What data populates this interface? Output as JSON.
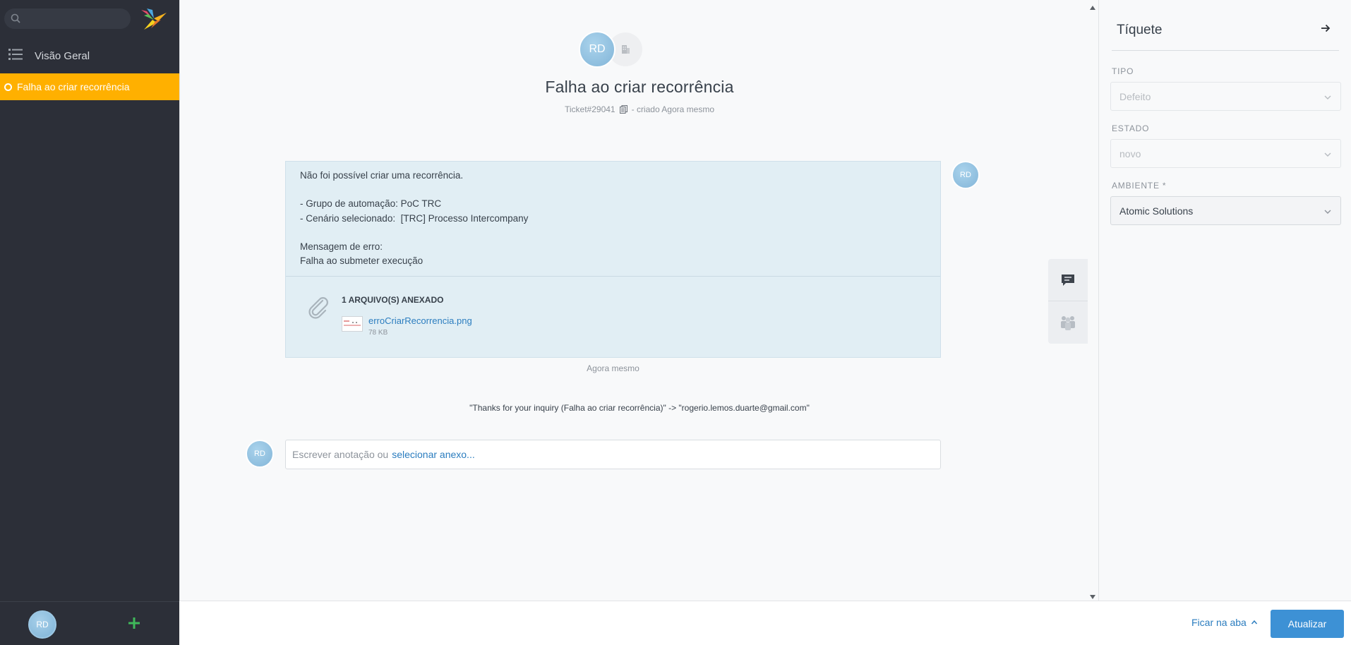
{
  "sidebar": {
    "search": {
      "placeholder": "",
      "value": ""
    },
    "overview_label": "Visão Geral",
    "open_ticket_label": "Falha ao criar recorrência",
    "user_initials": "RD"
  },
  "ticket": {
    "title": "Falha ao criar recorrência",
    "number": "Ticket#29041",
    "created": "- criado Agora mesmo",
    "header_initials": "RD"
  },
  "article": {
    "lines": [
      "Não foi possível criar uma recorrência.",
      "",
      "- Grupo de automação: PoC TRC",
      "- Cenário selecionado:  [TRC] Processo Intercompany",
      "",
      "Mensagem de erro:",
      "Falha ao submeter execução"
    ],
    "attachments_heading": "1 ARQUIVO(S) ANEXADO",
    "attachment": {
      "name": "erroCriarRecorrencia.png",
      "size": "78 KB"
    },
    "time": "Agora mesmo",
    "author_initials": "RD"
  },
  "trigger_note": "\"Thanks for your inquiry (Falha ao criar recorrência)\" -> \"rogerio.lemos.duarte@gmail.com\"",
  "note": {
    "author_initials": "RD",
    "placeholder": "Escrever anotação ou",
    "link": "selecionar anexo..."
  },
  "panel": {
    "title": "Tíquete",
    "fields": [
      {
        "label": "TIPO",
        "value": "Defeito"
      },
      {
        "label": "ESTADO",
        "value": "novo"
      },
      {
        "label": "AMBIENTE *",
        "value": "Atomic Solutions"
      }
    ]
  },
  "bottom": {
    "stay_label": "Ficar na aba",
    "update_label": "Atualizar"
  },
  "colors": {
    "sidebar_bg": "#2c2f38",
    "active_ticket": "#ffb000",
    "primary_button": "#3d91d5",
    "link": "#2b7dbf",
    "article_bg": "#e1eef4"
  }
}
